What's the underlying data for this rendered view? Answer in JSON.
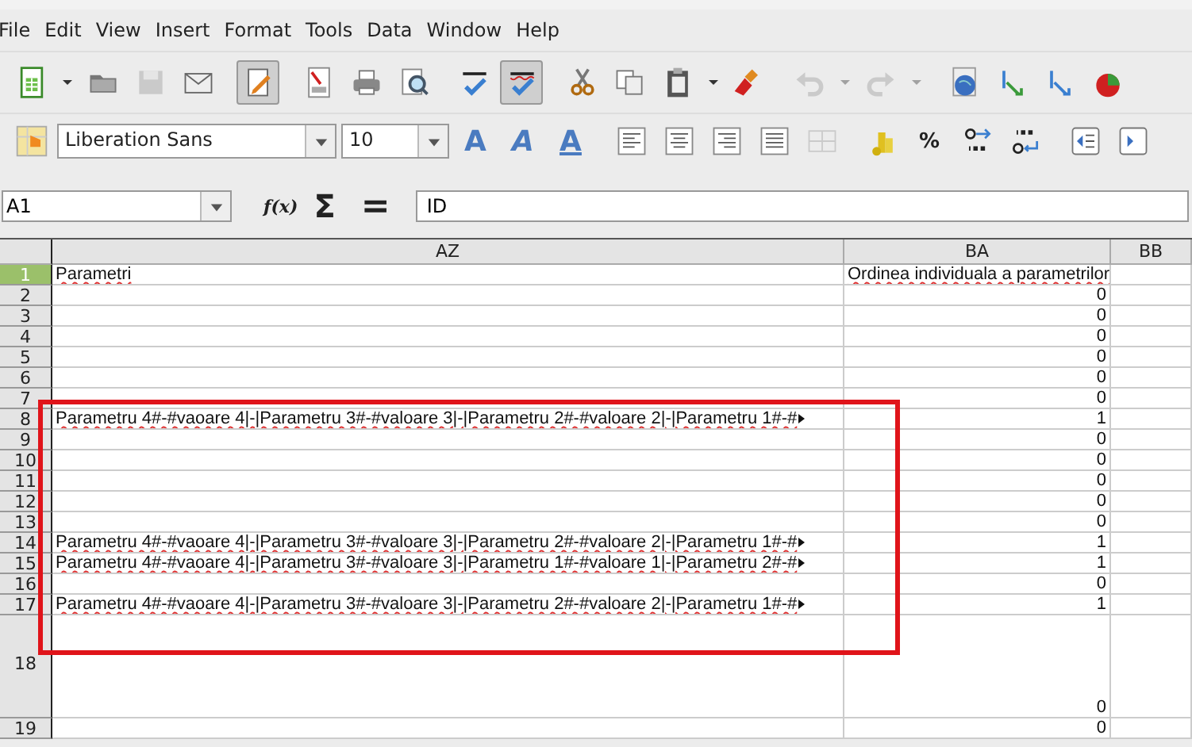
{
  "menu": [
    "File",
    "Edit",
    "View",
    "Insert",
    "Format",
    "Tools",
    "Data",
    "Window",
    "Help"
  ],
  "toolbar": [
    {
      "kind": "new",
      "pressed": false,
      "disabled": false
    },
    {
      "kind": "caret",
      "pressed": false,
      "disabled": false
    },
    {
      "kind": "open",
      "pressed": false,
      "disabled": false
    },
    {
      "kind": "save",
      "pressed": false,
      "disabled": true
    },
    {
      "kind": "email",
      "pressed": false,
      "disabled": false
    },
    {
      "kind": "sep"
    },
    {
      "kind": "edit",
      "pressed": true,
      "disabled": false
    },
    {
      "kind": "sep"
    },
    {
      "kind": "pdf",
      "pressed": false,
      "disabled": false
    },
    {
      "kind": "print",
      "pressed": false,
      "disabled": false
    },
    {
      "kind": "preview",
      "pressed": false,
      "disabled": false
    },
    {
      "kind": "sep"
    },
    {
      "kind": "spell",
      "pressed": false,
      "disabled": false
    },
    {
      "kind": "autospell",
      "pressed": true,
      "disabled": false
    },
    {
      "kind": "sep"
    },
    {
      "kind": "cut",
      "pressed": false,
      "disabled": false
    },
    {
      "kind": "copy",
      "pressed": false,
      "disabled": false
    },
    {
      "kind": "paste",
      "pressed": false,
      "disabled": false
    },
    {
      "kind": "caret",
      "pressed": false,
      "disabled": false
    },
    {
      "kind": "brush",
      "pressed": false,
      "disabled": false
    },
    {
      "kind": "sep"
    },
    {
      "kind": "undo",
      "pressed": false,
      "disabled": true
    },
    {
      "kind": "caret",
      "pressed": false,
      "disabled": true
    },
    {
      "kind": "redo",
      "pressed": false,
      "disabled": true
    },
    {
      "kind": "caret",
      "pressed": false,
      "disabled": true
    },
    {
      "kind": "sep"
    },
    {
      "kind": "globe",
      "pressed": false,
      "disabled": false
    },
    {
      "kind": "sortasc",
      "pressed": false,
      "disabled": false
    },
    {
      "kind": "sortdesc",
      "pressed": false,
      "disabled": false
    },
    {
      "kind": "chart",
      "pressed": false,
      "disabled": false
    }
  ],
  "format_bar": {
    "font_name": "Liberation Sans",
    "font_size": "10",
    "buttons": [
      {
        "kind": "bold",
        "label": "A",
        "disabled": false
      },
      {
        "kind": "italic",
        "label": "A",
        "disabled": false
      },
      {
        "kind": "underline",
        "label": "A",
        "disabled": false
      },
      {
        "kind": "sep"
      },
      {
        "kind": "left",
        "disabled": false
      },
      {
        "kind": "center",
        "disabled": false
      },
      {
        "kind": "right",
        "disabled": false
      },
      {
        "kind": "justify",
        "disabled": false
      },
      {
        "kind": "merge",
        "disabled": true
      },
      {
        "kind": "sep"
      },
      {
        "kind": "currency",
        "disabled": false
      },
      {
        "kind": "percent",
        "label": "%",
        "disabled": false
      },
      {
        "kind": "adddec",
        "disabled": false
      },
      {
        "kind": "deldec",
        "disabled": false
      },
      {
        "kind": "sep"
      },
      {
        "kind": "outdent",
        "disabled": false
      },
      {
        "kind": "indent",
        "disabled": false
      }
    ]
  },
  "formula_bar": {
    "cell_ref": "A1",
    "function_wizard": "f(x)",
    "sum": "Σ",
    "equals": "=",
    "content": "ID"
  },
  "columns": [
    {
      "label": "AZ"
    },
    {
      "label": "BA"
    },
    {
      "label": "BB"
    }
  ],
  "rows": [
    {
      "num": "1",
      "selected": true,
      "tall": false,
      "az": "Parametri",
      "ba": "Ordinea individuala a parametrilor",
      "spell_error": true,
      "overflow": false
    },
    {
      "num": "2",
      "selected": false,
      "tall": false,
      "ba": "0"
    },
    {
      "num": "3",
      "selected": false,
      "tall": false,
      "ba": "0"
    },
    {
      "num": "4",
      "selected": false,
      "tall": false,
      "ba": "0"
    },
    {
      "num": "5",
      "selected": false,
      "tall": false,
      "ba": "0"
    },
    {
      "num": "6",
      "selected": false,
      "tall": false,
      "ba": "0"
    },
    {
      "num": "7",
      "selected": false,
      "tall": false,
      "ba": "0"
    },
    {
      "num": "8",
      "selected": false,
      "tall": false,
      "az": "Parametru 4#-#vaoare 4|-|Parametru 3#-#valoare 3|-|Parametru 2#-#valoare 2|-|Parametru 1#-#",
      "ba": "1",
      "spell_error": true,
      "overflow": true
    },
    {
      "num": "9",
      "selected": false,
      "tall": false,
      "ba": "0"
    },
    {
      "num": "10",
      "selected": false,
      "tall": false,
      "ba": "0"
    },
    {
      "num": "11",
      "selected": false,
      "tall": false,
      "ba": "0"
    },
    {
      "num": "12",
      "selected": false,
      "tall": false,
      "ba": "0"
    },
    {
      "num": "13",
      "selected": false,
      "tall": false,
      "ba": "0"
    },
    {
      "num": "14",
      "selected": false,
      "tall": false,
      "az": "Parametru 4#-#vaoare 4|-|Parametru 3#-#valoare 3|-|Parametru 2#-#valoare 2|-|Parametru 1#-#",
      "ba": "1",
      "spell_error": true,
      "overflow": true
    },
    {
      "num": "15",
      "selected": false,
      "tall": false,
      "az": "Parametru 4#-#vaoare 4|-|Parametru 3#-#valoare 3|-|Parametru 1#-#valoare 1|-|Parametru 2#-#",
      "ba": "1",
      "spell_error": true,
      "overflow": true
    },
    {
      "num": "16",
      "selected": false,
      "tall": false,
      "ba": "0"
    },
    {
      "num": "17",
      "selected": false,
      "tall": false,
      "az": "Parametru 4#-#vaoare 4|-|Parametru 3#-#valoare 3|-|Parametru 2#-#valoare 2|-|Parametru 1#-#",
      "ba": "1",
      "spell_error": true,
      "overflow": true
    },
    {
      "num": "18",
      "selected": false,
      "tall": true,
      "ba": "0"
    },
    {
      "num": "19",
      "selected": false,
      "tall": false,
      "ba": "0"
    }
  ],
  "annotation": {
    "kind": "rectangle"
  }
}
